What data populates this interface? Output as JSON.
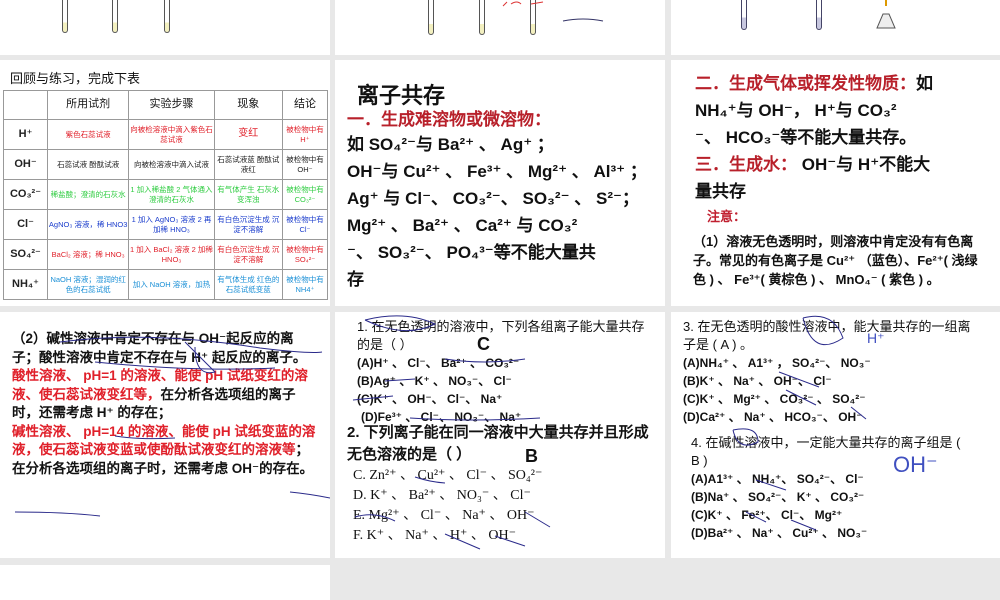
{
  "slide_table": {
    "title": "回顾与练习，完成下表",
    "headers": [
      "",
      "所用试剂",
      "实验步骤",
      "现象",
      "结论"
    ],
    "rows": [
      {
        "ion": "H⁺",
        "reagent": "紫色石蕊试液",
        "steps": "向被检溶液中滴入紫色石蕊试液",
        "phenomenon": "变红",
        "conclusion": "被检物中有 H⁺",
        "color": "red"
      },
      {
        "ion": "OH⁻",
        "reagent": "石蕊试液 酚酞试液",
        "steps": "向被检溶液中滴入试液",
        "phenomenon": "石蕊试液蓝 酚酞试液红",
        "conclusion": "被检物中有 OH⁻",
        "color": "blk"
      },
      {
        "ion": "CO₃²⁻",
        "reagent": "稀盐酸；澄清的石灰水",
        "steps": "1 加入稀盐酸 2 气体通入澄清的石灰水",
        "phenomenon": "有气体产生 石灰水变浑浊",
        "conclusion": "被检物中有 CO₃²⁻",
        "color": "grn"
      },
      {
        "ion": "Cl⁻",
        "reagent": "AgNO₃ 溶液，稀 HNO3",
        "steps": "1 加入 AgNO₃ 溶液 2 再加稀 HNO₃",
        "phenomenon": "有白色沉淀生成 沉淀不溶解",
        "conclusion": "被检物中有 Cl⁻",
        "color": "blu"
      },
      {
        "ion": "SO₄²⁻",
        "reagent": "BaCl₂ 溶液；稀 HNO₃",
        "steps": "1 加入 BaCl₂ 溶液 2 加稀 HNO₃",
        "phenomenon": "有白色沉淀生成 沉淀不溶解",
        "conclusion": "被检物中有 SO₄²⁻",
        "color": "red"
      },
      {
        "ion": "NH₄⁺",
        "reagent": "NaOH 溶液；湿润的红色的石蕊试纸",
        "steps": "加入 NaOH 溶液，加热",
        "phenomenon": "有气体生成 红色的石蕊试纸变蓝",
        "conclusion": "被检物中有 NH4⁺",
        "color": "cyn"
      }
    ]
  },
  "slide_coexist": {
    "title": "离子共存",
    "heading": "一．生成难溶物或微溶物：",
    "lines": [
      "如 SO₄²⁻与 Ba²⁺ 、 Ag⁺ ；",
      "OH⁻与 Cu²⁺ 、 Fe³⁺ 、 Mg²⁺ 、 Al³⁺ ；",
      "Ag⁺ 与 Cl⁻、 CO₃²⁻、 SO₃²⁻ 、 S²⁻；",
      "Mg²⁺ 、 Ba²⁺ 、 Ca²⁺ 与 CO₃²",
      "⁻、 SO₃²⁻、 PO₄³⁻等不能大量共",
      "存"
    ]
  },
  "slide_gas": {
    "heading2": "二．生成气体或挥发性物质：",
    "line2a": "如",
    "line2b": "NH₄⁺与 OH⁻， H⁺与 CO₃²",
    "line2c": "⁻、 HCO₃⁻等不能大量共存。",
    "heading3": "三．生成水：",
    "line3a": " OH⁻与 H⁺不能大",
    "line3b": "量共存",
    "note_label": "注意：",
    "note1": "（1）溶液无色透明时，则溶液中肯定没有有色离子。常见的有色离子是 Cu²⁺ （蓝色）、Fe²⁺( 浅绿色 ) 、 Fe³⁺( 黄棕色 ) 、 MnO₄⁻ ( 紫色 ) 。"
  },
  "slide_note2": {
    "p1": "（2）碱性溶液中肯定不存在与 OH⁻起反应的离子；酸性溶液中肯定不存在与 H⁺ 起反应的离子。",
    "p2_red": "酸性溶液、 pH=1 的溶液、能使 pH 试纸变红的溶液、使石蕊试液变红等，",
    "p2_black": "在分析各选项组的离子时，还需考虑 H⁺ 的存在；",
    "p3_red": "碱性溶液、 pH=14 的溶液、能使 pH 试纸变蓝的溶液，使石蕊试液变蓝或使酚酞试液变红的溶液等",
    "p3_black": "；在分析各选项组的离子时，还需考虑 OH⁻的存在。"
  },
  "slide_q12": {
    "q1": "1. 在无色透明的溶液中，下列各组离子能大量共存的是（              ）",
    "q1_answer": "C",
    "q1_options": [
      "(A)H⁺ 、 Cl⁻、 Ba²⁺ 、 CO₃²⁻",
      "(B)Ag⁺ 、 K⁺ 、 NO₃⁻、 Cl⁻",
      "(C)K⁺ 、 OH⁻、 Cl⁻、 Na⁺",
      "(D)Fe³⁺ 、 Cl⁻、 NO₃⁻、 Na⁺"
    ],
    "q2": "2. 下列离子能在同一溶液中大量共存并且形成无色溶液的是（     ）",
    "q2_answer": "B",
    "q2_options": [
      "C. Zn²⁺ 、 Cu²⁺ 、 Cl⁻ 、 SO₄²⁻",
      "D. K⁺ 、 Ba²⁺ 、 NO₃⁻ 、 Cl⁻",
      "E. Mg²⁺ 、 Cl⁻ 、 Na⁺ 、 OH⁻",
      "F. K⁺ 、 Na⁺ 、 H⁺ 、 OH⁻"
    ]
  },
  "slide_q34": {
    "q3": "3. 在无色透明的酸性溶液中，能大量共存的一组离子是 ( A ) 。",
    "q3_options": [
      "(A)NH₄⁺ 、 A1³⁺ ， SO₄²⁻、 NO₃⁻",
      "(B)K⁺ 、 Na⁺ 、 OH⁻、 Cl⁻",
      "(C)K⁺ 、 Mg²⁺ 、 CO₃²⁻ 、 SO₄²⁻",
      "(D)Ca²⁺ 、 Na⁺ 、 HCO₃⁻、 OH⁻"
    ],
    "q4": "4. 在碱性溶液中，一定能大量共存的离子组是 ( B )",
    "q4_options": [
      "(A)A1³⁺ 、 NH₄⁺、 SO₄²⁻、 Cl⁻",
      "(B)Na⁺ 、 SO₄²⁻、 K⁺ 、 CO₃²⁻",
      "(C)K⁺ 、 Fe²⁺、 Cl⁻、 Mg²⁺",
      "(D)Ba²⁺ 、 Na⁺ 、 Cu²⁺ 、 NO₃⁻"
    ],
    "ink_h": "H⁺",
    "ink_oh": "OH⁻"
  }
}
